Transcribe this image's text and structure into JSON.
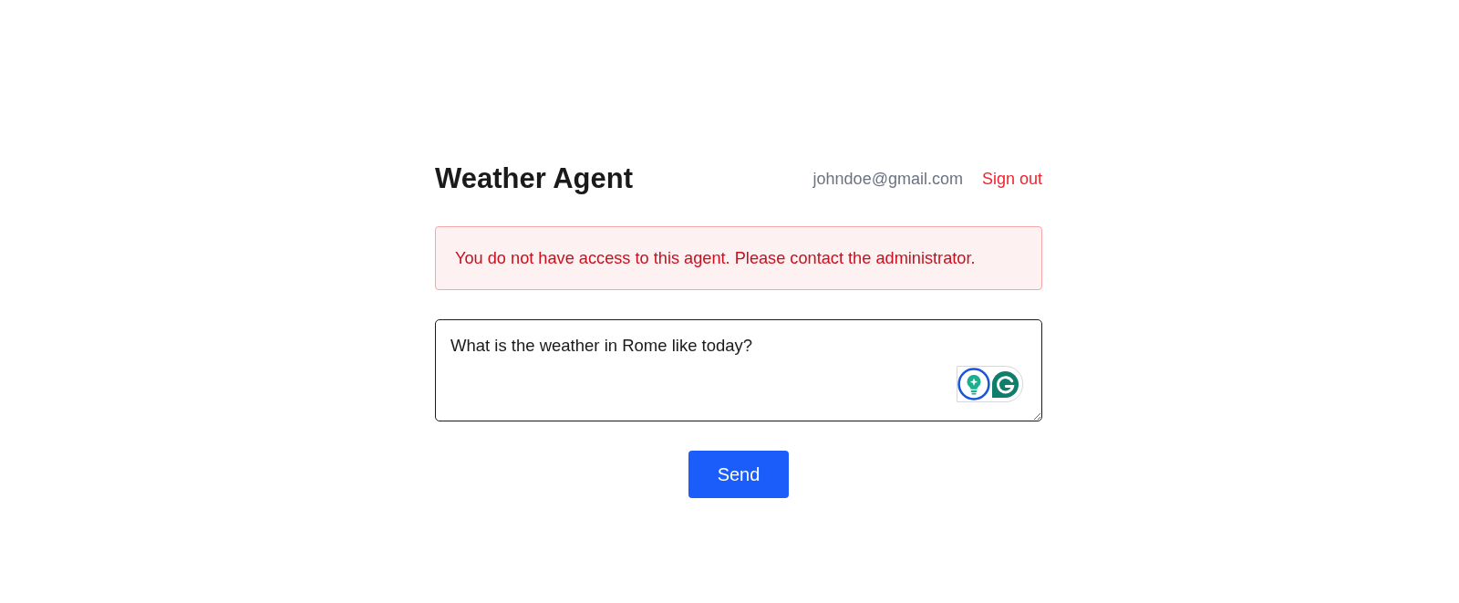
{
  "header": {
    "title": "Weather Agent",
    "user_email": "johndoe@gmail.com",
    "sign_out": "Sign out"
  },
  "alert": {
    "kind": "error",
    "message": "You do not have access to this agent. Please contact the administrator."
  },
  "prompt": {
    "value": "What is the weather in Rome like today?"
  },
  "send_button": {
    "label": "Send"
  }
}
